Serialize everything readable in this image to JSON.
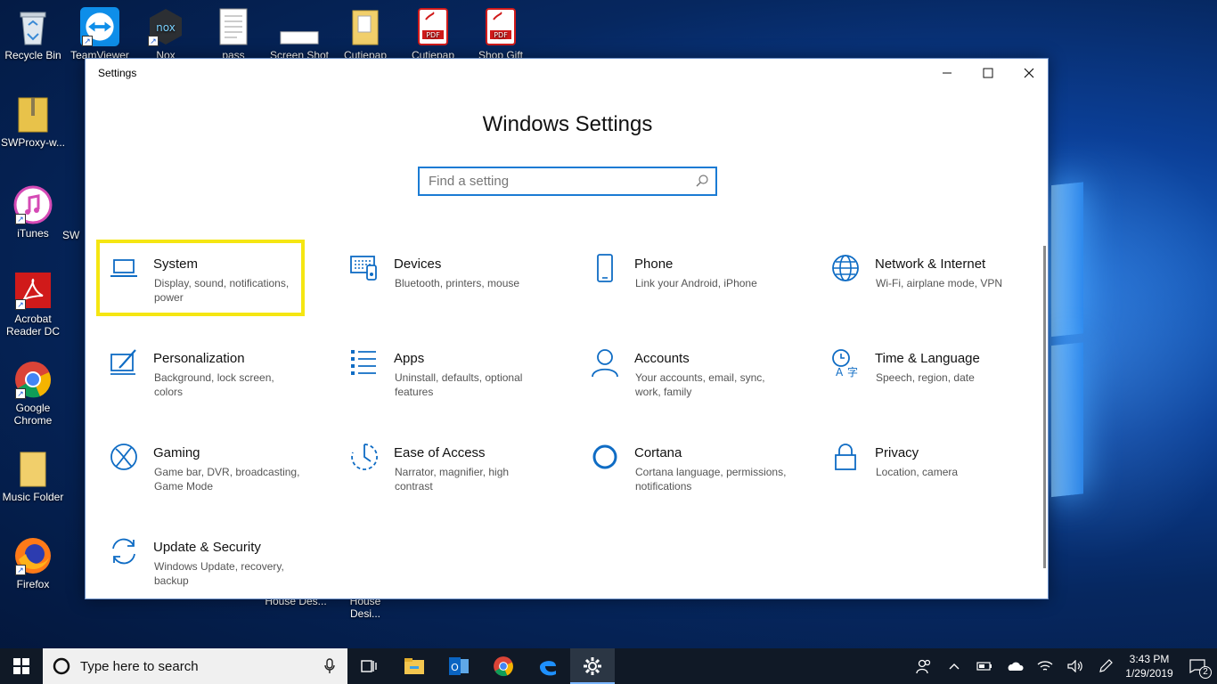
{
  "desktop": {
    "icons": [
      {
        "label": "Recycle Bin"
      },
      {
        "label": "TeamViewer"
      },
      {
        "label": "Nox"
      },
      {
        "label": "pass"
      },
      {
        "label": "Screen Shot"
      },
      {
        "label": "Cutiepap"
      },
      {
        "label": "Cutiepap"
      },
      {
        "label": "Shop Gift"
      },
      {
        "label": "SWProxy-w..."
      },
      {
        "label": "iTunes"
      },
      {
        "label": "SW"
      },
      {
        "label": "Acrobat Reader DC"
      },
      {
        "label": "Google Chrome"
      },
      {
        "label": "Music Folder"
      },
      {
        "label": "Firefox"
      },
      {
        "label": "House Des..."
      },
      {
        "label": "House Desi..."
      }
    ]
  },
  "window": {
    "title": "Settings",
    "heading": "Windows Settings",
    "search_placeholder": "Find a setting",
    "tiles": [
      {
        "icon": "laptop-icon",
        "title": "System",
        "desc": "Display, sound, notifications, power"
      },
      {
        "icon": "keyboard-icon",
        "title": "Devices",
        "desc": "Bluetooth, printers, mouse"
      },
      {
        "icon": "phone-icon",
        "title": "Phone",
        "desc": "Link your Android, iPhone"
      },
      {
        "icon": "globe-icon",
        "title": "Network & Internet",
        "desc": "Wi-Fi, airplane mode, VPN"
      },
      {
        "icon": "paint-icon",
        "title": "Personalization",
        "desc": "Background, lock screen, colors"
      },
      {
        "icon": "apps-list-icon",
        "title": "Apps",
        "desc": "Uninstall, defaults, optional features"
      },
      {
        "icon": "person-icon",
        "title": "Accounts",
        "desc": "Your accounts, email, sync, work, family"
      },
      {
        "icon": "time-language-icon",
        "title": "Time & Language",
        "desc": "Speech, region, date"
      },
      {
        "icon": "xbox-icon",
        "title": "Gaming",
        "desc": "Game bar, DVR, broadcasting, Game Mode"
      },
      {
        "icon": "ease-of-access-icon",
        "title": "Ease of Access",
        "desc": "Narrator, magnifier, high contrast"
      },
      {
        "icon": "cortana-icon",
        "title": "Cortana",
        "desc": "Cortana language, permissions, notifications"
      },
      {
        "icon": "lock-icon",
        "title": "Privacy",
        "desc": "Location, camera"
      },
      {
        "icon": "sync-icon",
        "title": "Update & Security",
        "desc": "Windows Update, recovery, backup"
      }
    ],
    "accent": "#0f6cc4",
    "highlight_color": "#f5e612"
  },
  "taskbar": {
    "search_placeholder": "Type here to search",
    "time": "3:43 PM",
    "date": "1/29/2019",
    "notification_count": "2"
  }
}
